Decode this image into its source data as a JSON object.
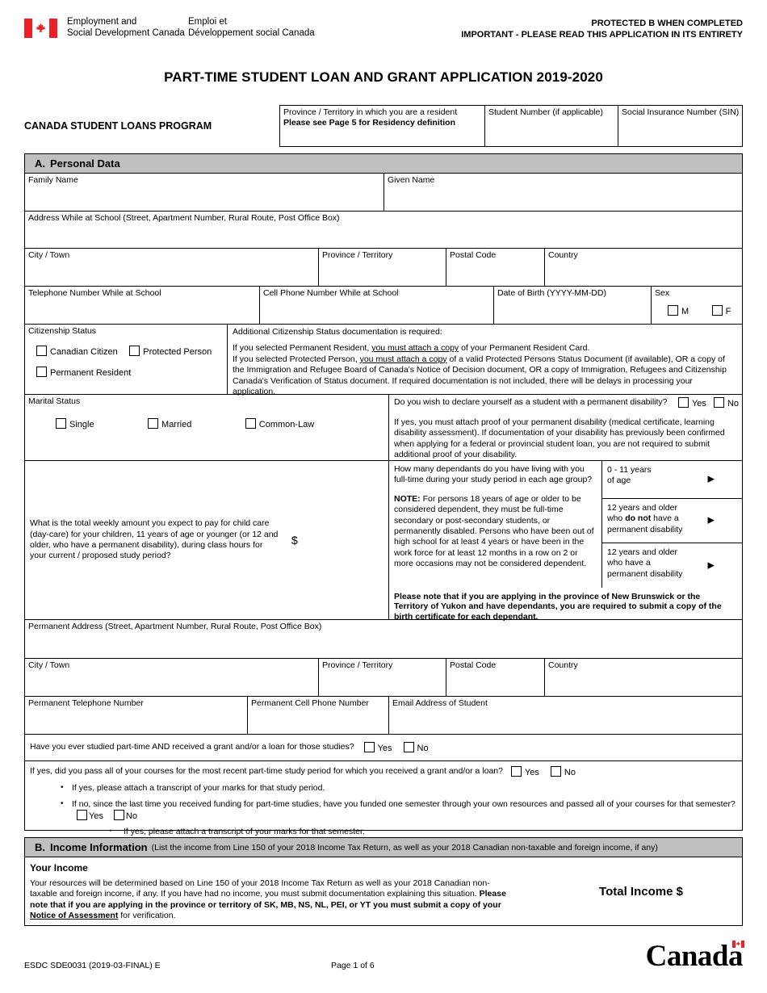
{
  "header": {
    "dept_en_line1": "Employment and",
    "dept_en_line2": "Social Development Canada",
    "dept_fr_line1": "Emploi et",
    "dept_fr_line2": "Développement social Canada",
    "protected_line1": "PROTECTED B WHEN COMPLETED",
    "protected_line2": "IMPORTANT - PLEASE READ THIS APPLICATION IN ITS ENTIRETY",
    "form_title": "PART-TIME STUDENT LOAN AND GRANT APPLICATION 2019-2020",
    "program_name": "CANADA STUDENT LOANS PROGRAM",
    "province_label": "Province / Territory in which you are a resident",
    "province_note": "Please see Page 5 for Residency definition",
    "student_number_label": "Student Number (if applicable)",
    "sin_label": "Social Insurance Number (SIN)"
  },
  "section_a": {
    "letter": "A.",
    "title": "Personal Data",
    "family_name": "Family Name",
    "given_name": "Given Name",
    "address_school": "Address While at School (Street, Apartment Number, Rural Route, Post Office Box)",
    "city_town": "City / Town",
    "province_territory": "Province / Territory",
    "postal_code": "Postal Code",
    "country": "Country",
    "telephone_school": "Telephone Number While at School",
    "cell_school": "Cell Phone Number While at School",
    "dob": "Date of Birth (YYYY-MM-DD)",
    "sex_label": "Sex",
    "sex_m": "M",
    "sex_f": "F",
    "citizenship": {
      "heading": "Citizenship Status",
      "option_canadian": "Canadian Citizen",
      "option_protected": "Protected Person",
      "option_permanent": "Permanent Resident",
      "doc_heading": "Additional Citizenship Status documentation is required:",
      "doc_line1_a": "If you selected Permanent Resident, ",
      "doc_line1_u": "you must attach a copy",
      "doc_line1_b": " of your Permanent Resident Card.",
      "doc_line2_a": "If you selected Protected Person, ",
      "doc_line2_u": "you must attach a copy",
      "doc_line2_b": " of a valid Protected Persons Status Document (if available), OR a copy of the Immigration and Refugee Board of Canada's Notice of Decision document, OR a copy of Immigration, Refugees and Citizenship Canada's Verification of Status document. If required documentation is not included, there will be delays in processing your application."
    },
    "marital": {
      "heading": "Marital Status",
      "option_single": "Single",
      "option_married": "Married",
      "option_commonlaw": "Common-Law"
    },
    "disability": {
      "question": "Do you wish to declare yourself as a student with a permanent disability?",
      "yes": "Yes",
      "no": "No",
      "note": "If yes, you must attach proof of your permanent disability (medical certificate, learning disability assessment). If documentation of your disability has previously been confirmed when applying for a federal or provincial student loan, you are not required to submit additional proof of your disability."
    },
    "childcare": {
      "question": "What is the total weekly amount you expect to pay for child care (day-care) for your children, 11 years of age or younger (or 12 and older, who have a permanent disability), during class hours for your current / proposed study period?",
      "currency": "$"
    },
    "dependants": {
      "question": "How many dependants do you have living with you full-time during your study period in each age group?",
      "note_label": "NOTE:",
      "note_text": " For persons 18 years of age or older to be considered dependent, they must be full-time secondary or post-secondary students, or permanently disabled. Persons who have been out of high school for at least 4 years or have been in the work force for at least 12 months in a row on 2 or more occasions may not be considered dependent.",
      "warning": "Please note that if you are applying in the province of New Brunswick or the Territory of Yukon and have dependants, you are required to submit a copy of the birth certificate for each dependant.",
      "groups": [
        {
          "line1": "0 - 11 years",
          "line2": "of age",
          "line3": ""
        },
        {
          "line1": "12 years and older",
          "line2_a": "who ",
          "line2_b": "do not",
          "line2_c": " have a",
          "line3": "permanent disability"
        },
        {
          "line1": "12 years and older",
          "line2_a": "who have a",
          "line2_b": "",
          "line2_c": "",
          "line3": "permanent disability"
        }
      ]
    },
    "permanent_address": "Permanent Address (Street, Apartment Number, Rural Route, Post Office Box)",
    "perm_telephone": "Permanent Telephone Number",
    "perm_cell": "Permanent Cell Phone Number",
    "email": "Email Address of Student",
    "studied_parttime_q": "Have you ever studied part-time AND received a grant and/or a loan for those studies?",
    "yes": "Yes",
    "no": "No",
    "pass_courses_q": "If yes, did you pass all of your courses for the most recent part-time study period for which you received a grant and/or a loan?",
    "bullet_1": "If yes, please attach a transcript of your marks for that study period.",
    "bullet_2_a": "If no, since the last time you received funding for part-time studies, have you funded one semester through your own resources and passed all of your courses for that semester?",
    "bullet_2_sub": "If yes, please attach a transcript of your marks for that semester."
  },
  "section_b": {
    "letter": "B.",
    "title": "Income Information",
    "subtitle": "(List the income from Line 150 of your 2018 Income Tax Return, as well as your 2018 Canadian non-taxable and foreign income, if any)",
    "your_income": "Your Income",
    "text_a": "Your resources will be determined based on Line 150 of your 2018 Income Tax Return as well as your 2018 Canadian non-taxable and foreign income, if any. If you have had no income, you must submit documentation explaining this situation. ",
    "text_b": "Please note that if you are applying in the province or territory of SK, MB, NS, NL, PEI, or YT you must submit a copy of your ",
    "text_u": "Notice of Assessment",
    "text_c": " for verification.",
    "total_income": "Total Income $"
  },
  "footer": {
    "form_code": "ESDC SDE0031 (2019-03-FINAL) E",
    "page": "Page 1 of 6",
    "wordmark": "Canada"
  },
  "colors": {
    "section_bar": "#c0c0c0",
    "flag_red": "#ea2127",
    "border": "#000000"
  }
}
